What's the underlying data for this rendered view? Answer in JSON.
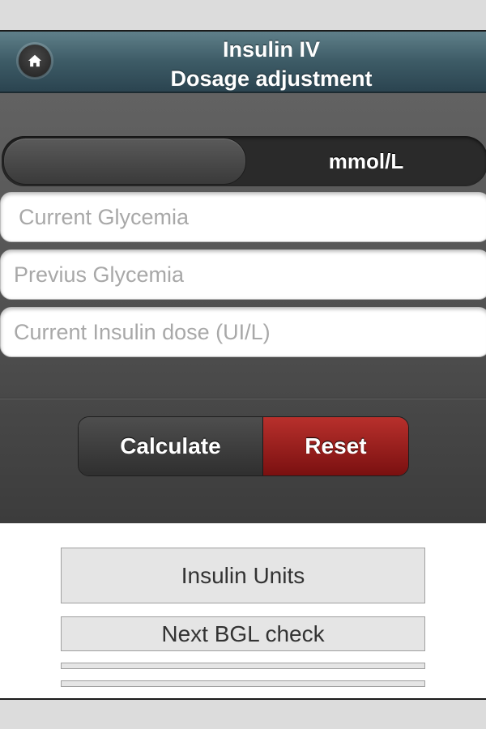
{
  "header": {
    "title_line1": "Insulin IV",
    "title_line2": "Dosage adjustment",
    "home_icon": "home-icon"
  },
  "unit_toggle": {
    "label": "mmol/L"
  },
  "fields": {
    "current_glycemia_placeholder": "Current Glycemia",
    "previous_glycemia_placeholder": "Previus Glycemia",
    "current_insulin_placeholder": "Current Insulin dose (UI/L)"
  },
  "actions": {
    "calculate_label": "Calculate",
    "reset_label": "Reset"
  },
  "results": {
    "insulin_units_label": "Insulin Units",
    "next_bgl_label": "Next BGL check"
  },
  "colors": {
    "header": "#3d5b66",
    "reset_button": "#a0201c",
    "background_dark": "#555555"
  }
}
